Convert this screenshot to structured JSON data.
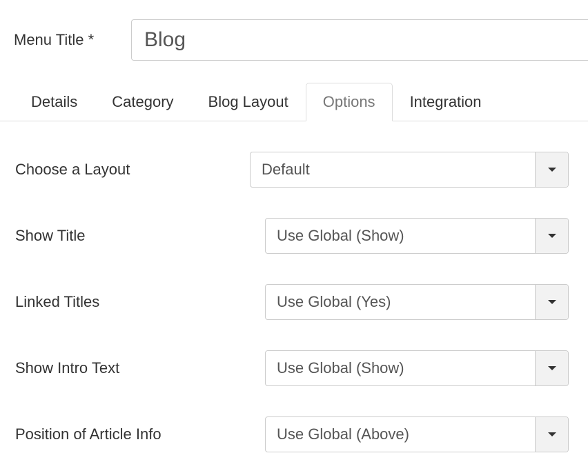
{
  "titleField": {
    "label": "Menu Title *",
    "value": "Blog"
  },
  "tabs": {
    "details": "Details",
    "category": "Category",
    "blogLayout": "Blog Layout",
    "options": "Options",
    "integration": "Integration",
    "active": "options"
  },
  "options": {
    "chooseLayout": {
      "label": "Choose a Layout",
      "value": "Default"
    },
    "showTitle": {
      "label": "Show Title",
      "value": "Use Global (Show)"
    },
    "linkedTitles": {
      "label": "Linked Titles",
      "value": "Use Global (Yes)"
    },
    "showIntroText": {
      "label": "Show Intro Text",
      "value": "Use Global (Show)"
    },
    "positionArticleInfo": {
      "label": "Position of Article Info",
      "value": "Use Global (Above)"
    }
  }
}
